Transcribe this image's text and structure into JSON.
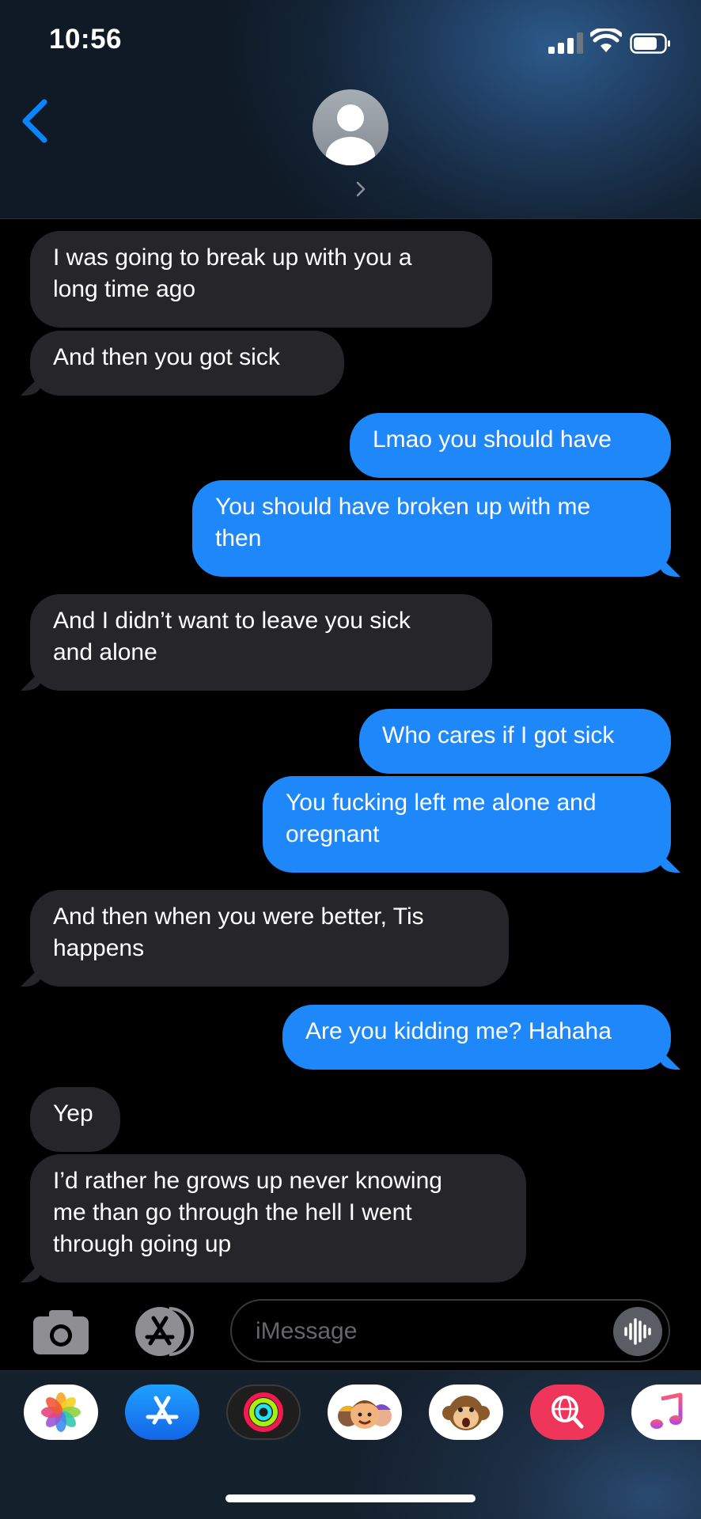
{
  "status_bar": {
    "time": "10:56"
  },
  "composer": {
    "placeholder": "iMessage"
  },
  "messages": [
    {
      "dir": "in",
      "text": "I was going to break up with you a\nlong time ago"
    },
    {
      "dir": "in",
      "text": "And then you got sick"
    },
    {
      "dir": "out",
      "text": "Lmao you should have"
    },
    {
      "dir": "out",
      "text": "You should have broken up with me\nthen"
    },
    {
      "dir": "in",
      "text": "And I didn’t want to leave you sick\nand alone"
    },
    {
      "dir": "out",
      "text": "Who cares if I got sick"
    },
    {
      "dir": "out",
      "text": "You fucking left me alone and\noregnant"
    },
    {
      "dir": "in",
      "text": "And then when you were better, Tis\nhappens"
    },
    {
      "dir": "out",
      "text": "Are you kidding me? Hahaha"
    },
    {
      "dir": "in",
      "text": "Yep"
    },
    {
      "dir": "in",
      "text": "I’d rather he grows up never knowing\nme than go through the hell I went\nthrough going up"
    }
  ],
  "app_drawer": [
    {
      "name": "photos-app-icon"
    },
    {
      "name": "app-store-app-icon"
    },
    {
      "name": "fitness-app-icon"
    },
    {
      "name": "memoji-stickers-icon"
    },
    {
      "name": "animoji-icon"
    },
    {
      "name": "images-search-icon"
    },
    {
      "name": "music-app-icon"
    }
  ],
  "colors": {
    "incoming": "#26262a",
    "outgoing": "#1e88fb",
    "accent": "#0a84ff"
  }
}
